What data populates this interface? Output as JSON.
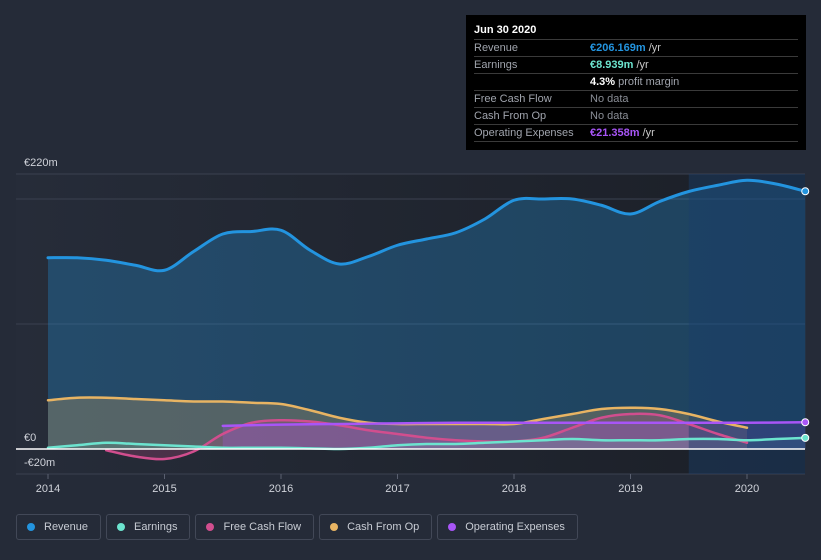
{
  "tooltip": {
    "date": "Jun 30 2020",
    "rows": [
      {
        "label": "Revenue",
        "value": "€206.169m",
        "unit": " /yr",
        "color": "#2394df"
      },
      {
        "label": "Earnings",
        "value": "€8.939m",
        "unit": " /yr",
        "color": "#6ce4cf"
      },
      {
        "label": "",
        "value": "4.3%",
        "unit": " profit margin",
        "color": "#ffffff"
      },
      {
        "label": "Free Cash Flow",
        "value": "No data",
        "unit": "",
        "color": "#8a8e96"
      },
      {
        "label": "Cash From Op",
        "value": "No data",
        "unit": "",
        "color": "#8a8e96"
      },
      {
        "label": "Operating Expenses",
        "value": "€21.358m",
        "unit": " /yr",
        "color": "#a855f7"
      }
    ]
  },
  "chart_data": {
    "type": "line",
    "title": "",
    "xlabel": "",
    "ylabel": "",
    "ylim": [
      -20,
      220
    ],
    "xlim": [
      2014,
      2020.5
    ],
    "y_tick_labels": [
      "€220m",
      "€0",
      "-€20m"
    ],
    "x_tick_labels": [
      "2014",
      "2015",
      "2016",
      "2017",
      "2018",
      "2019",
      "2020"
    ],
    "gridlines": [
      220,
      200,
      100,
      0
    ],
    "highlight_start": 2019.5,
    "series": [
      {
        "name": "Revenue",
        "color": "#2394df",
        "x": [
          2014,
          2014.25,
          2014.5,
          2014.75,
          2015,
          2015.25,
          2015.5,
          2015.75,
          2016,
          2016.25,
          2016.5,
          2016.75,
          2017,
          2017.25,
          2017.5,
          2017.75,
          2018,
          2018.25,
          2018.5,
          2018.75,
          2019,
          2019.25,
          2019.5,
          2019.75,
          2020,
          2020.25,
          2020.5
        ],
        "y": [
          153,
          153,
          151,
          147,
          143,
          158,
          172,
          174,
          175,
          159,
          148,
          154,
          163,
          168,
          173,
          184,
          199,
          200,
          200,
          195,
          188,
          198,
          206,
          211,
          215,
          212,
          206.2
        ]
      },
      {
        "name": "Earnings",
        "color": "#6ce4cf",
        "x": [
          2014,
          2014.25,
          2014.5,
          2014.75,
          2015,
          2015.25,
          2015.5,
          2015.75,
          2016,
          2016.25,
          2016.5,
          2016.75,
          2017,
          2017.25,
          2017.5,
          2017.75,
          2018,
          2018.25,
          2018.5,
          2018.75,
          2019,
          2019.25,
          2019.5,
          2019.75,
          2020,
          2020.25,
          2020.5
        ],
        "y": [
          1,
          3,
          5,
          4,
          3,
          2,
          1,
          1,
          1,
          0.5,
          0,
          1,
          3,
          4,
          4,
          5,
          6,
          7,
          8,
          7,
          7,
          7,
          8,
          8,
          7,
          8,
          8.9
        ]
      },
      {
        "name": "Free Cash Flow",
        "color": "#d14e8e",
        "x": [
          2014.5,
          2014.75,
          2015,
          2015.25,
          2015.5,
          2015.75,
          2016,
          2016.25,
          2016.5,
          2016.75,
          2017,
          2017.25,
          2017.5,
          2017.75,
          2018,
          2018.25,
          2018.5,
          2018.75,
          2019,
          2019.25,
          2019.5,
          2019.75,
          2020
        ],
        "y": [
          -1,
          -6,
          -8,
          -2,
          12,
          21,
          23,
          22,
          19,
          15,
          12,
          9,
          7,
          6,
          6,
          9,
          17,
          25,
          28,
          27,
          20,
          12,
          5
        ]
      },
      {
        "name": "Cash From Op",
        "color": "#e8b463",
        "x": [
          2014,
          2014.25,
          2014.5,
          2014.75,
          2015,
          2015.25,
          2015.5,
          2015.75,
          2016,
          2016.25,
          2016.5,
          2016.75,
          2017,
          2017.25,
          2017.5,
          2017.75,
          2018,
          2018.25,
          2018.5,
          2018.75,
          2019,
          2019.25,
          2019.5,
          2019.75,
          2020
        ],
        "y": [
          39,
          41,
          41,
          40,
          39,
          38,
          38,
          37,
          36,
          31,
          25,
          21,
          20,
          20,
          20,
          20,
          20,
          24,
          28,
          32,
          33,
          32,
          28,
          22,
          17
        ]
      },
      {
        "name": "Operating Expenses",
        "color": "#a855f7",
        "x": [
          2015.5,
          2016,
          2016.5,
          2017,
          2017.5,
          2018,
          2018.5,
          2019,
          2019.5,
          2020,
          2020.5
        ],
        "y": [
          18.5,
          19.5,
          20,
          20.5,
          21,
          21,
          21,
          21,
          21,
          21,
          21.4
        ]
      }
    ]
  },
  "legend": [
    {
      "label": "Revenue",
      "color": "#2394df"
    },
    {
      "label": "Earnings",
      "color": "#6ce4cf"
    },
    {
      "label": "Free Cash Flow",
      "color": "#d14e8e"
    },
    {
      "label": "Cash From Op",
      "color": "#e8b463"
    },
    {
      "label": "Operating Expenses",
      "color": "#a855f7"
    }
  ]
}
